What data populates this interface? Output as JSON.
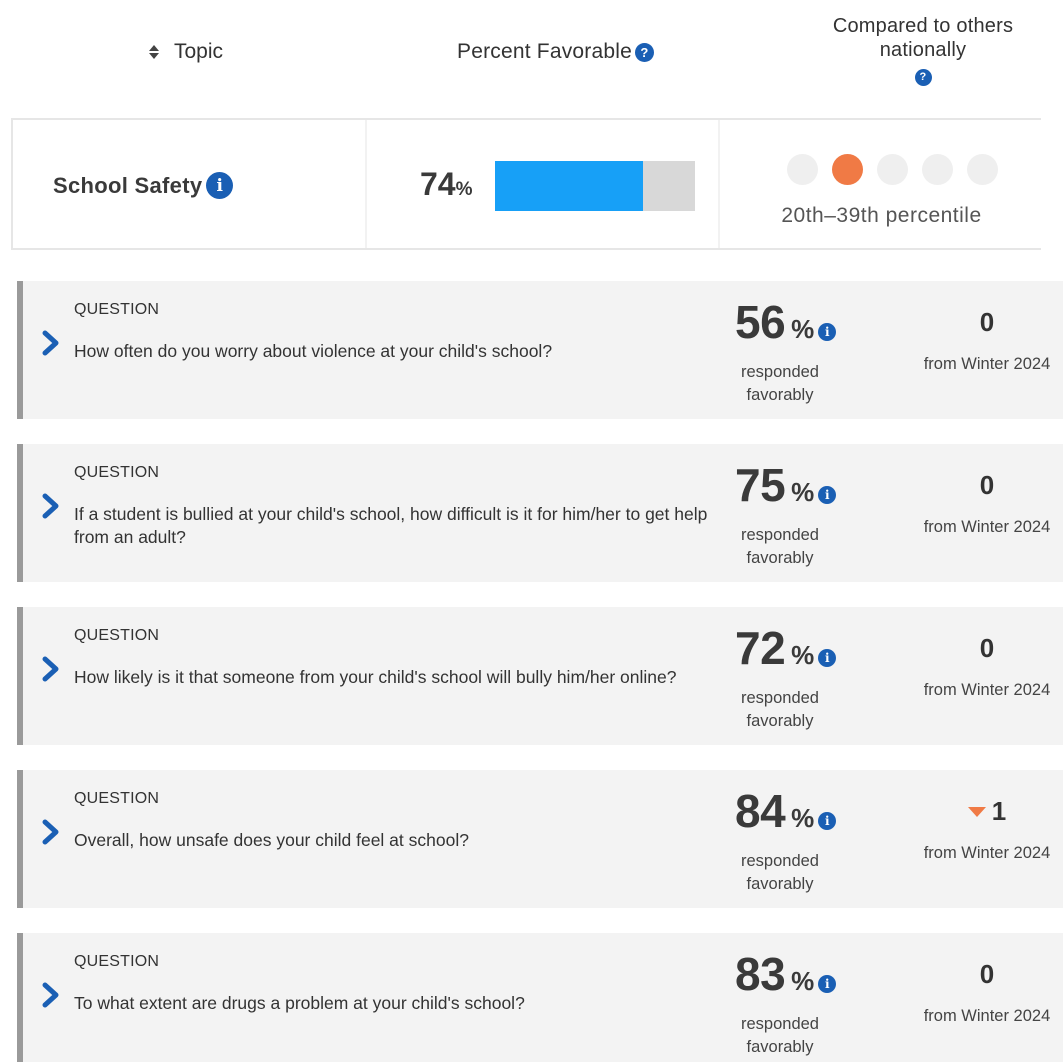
{
  "header": {
    "topic_label": "Topic",
    "percent_label": "Percent Favorable",
    "compare_line1": "Compared to others",
    "compare_line2": "nationally",
    "help_glyph": "?"
  },
  "topic": {
    "name": "School Safety",
    "info_glyph": "i",
    "percent": "74",
    "percent_sign": "%",
    "favorable_fraction": 0.74,
    "percentile_dots": 5,
    "active_dot_index": 1,
    "percentile_label": "20th–39th percentile",
    "colors": {
      "bar_fill": "#17a0f7",
      "bar_track": "#d8d8d8",
      "active_dot": "#f07a45",
      "inactive_dot": "#efefef"
    }
  },
  "questions": [
    {
      "label": "QUESTION",
      "text": "How often do you worry about violence at your child's school?",
      "percent": "56",
      "percent_sign": "%",
      "responded": "responded favorably",
      "change": "0",
      "change_dir": "none",
      "from": "from Winter 2024"
    },
    {
      "label": "QUESTION",
      "text": "If a student is bullied at your child's school, how difficult is it for him/her to get help from an adult?",
      "percent": "75",
      "percent_sign": "%",
      "responded": "responded favorably",
      "change": "0",
      "change_dir": "none",
      "from": "from Winter 2024"
    },
    {
      "label": "QUESTION",
      "text": "How likely is it that someone from your child's school will bully him/her online?",
      "percent": "72",
      "percent_sign": "%",
      "responded": "responded favorably",
      "change": "0",
      "change_dir": "none",
      "from": "from Winter 2024"
    },
    {
      "label": "QUESTION",
      "text": "Overall, how unsafe does your child feel at school?",
      "percent": "84",
      "percent_sign": "%",
      "responded": "responded favorably",
      "change": "1",
      "change_dir": "down",
      "from": "from Winter 2024"
    },
    {
      "label": "QUESTION",
      "text": "To what extent are drugs a problem at your child's school?",
      "percent": "83",
      "percent_sign": "%",
      "responded": "responded favorably",
      "change": "0",
      "change_dir": "none",
      "from": "from Winter 2024"
    }
  ],
  "icons": {
    "sort": "sort-icon",
    "help": "help-icon",
    "info": "info-icon",
    "expand": "chevron-right-icon",
    "trend_down": "triangle-down-icon"
  }
}
